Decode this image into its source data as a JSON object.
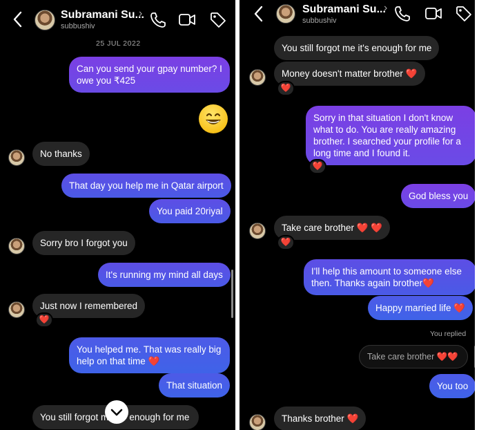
{
  "header": {
    "name": "Subramani Su...",
    "username": "subbushiv",
    "chevron": "›"
  },
  "icons": {
    "back": "back-chevron-icon",
    "call": "phone-icon",
    "video": "video-call-icon",
    "tag": "tag-icon",
    "scroll_down": "chevron-down-icon"
  },
  "colors": {
    "sent_bubble": "#5b47e0",
    "received_bubble": "#262626",
    "heart": "#ed4956",
    "background": "#000000"
  },
  "left": {
    "date": "25 JUL 2022",
    "messages": [
      {
        "side": "sent",
        "text_lines": [
          "Can you send your gpay number? I",
          "owe you ₹425"
        ]
      },
      {
        "side": "sent",
        "emoji": "😄"
      },
      {
        "side": "received",
        "text": "No thanks"
      },
      {
        "side": "sent",
        "text": "That day you help me in Qatar airport"
      },
      {
        "side": "sent",
        "text": "You paid 20riyal"
      },
      {
        "side": "received",
        "text": "Sorry bro I forgot you"
      },
      {
        "side": "sent",
        "text": "It's running my mind all days"
      },
      {
        "side": "received",
        "text": "Just now I remembered",
        "reaction": "❤️"
      },
      {
        "side": "sent",
        "text_lines": [
          "You helped me. That was really big",
          "help on that time"
        ],
        "heart": "❤️"
      },
      {
        "side": "sent",
        "text": "That situation"
      },
      {
        "side": "received",
        "text_a": "You still forgot m",
        "text_b": "enough for me"
      }
    ]
  },
  "right": {
    "messages": [
      {
        "side": "received",
        "text": "You still forgot me it's enough for me"
      },
      {
        "side": "received",
        "text": "Money doesn't matter brother",
        "heart": "❤️",
        "reaction": "❤️"
      },
      {
        "side": "sent",
        "text_lines": [
          "Sorry in that situation I don't know",
          "what to do. You are really amazing",
          "brother. I searched your profile for a",
          "long time and I found it."
        ],
        "reaction": "❤️"
      },
      {
        "side": "sent",
        "text": "God bless you"
      },
      {
        "side": "received",
        "text": "Take care brother",
        "hearts": "❤️ ❤️",
        "reaction": "❤️"
      },
      {
        "side": "sent",
        "text_lines": [
          "I'll help this amount to someone else",
          "then. Thanks again brother"
        ],
        "heart": "❤️"
      },
      {
        "side": "sent",
        "text": "Happy married life",
        "heart": "❤️"
      },
      {
        "side": "meta",
        "text": "You replied"
      },
      {
        "side": "quoted",
        "text": "Take care brother",
        "hearts": "❤️❤️"
      },
      {
        "side": "sent",
        "text": "You too"
      },
      {
        "side": "received",
        "text": "Thanks brother",
        "heart": "❤️"
      }
    ]
  }
}
